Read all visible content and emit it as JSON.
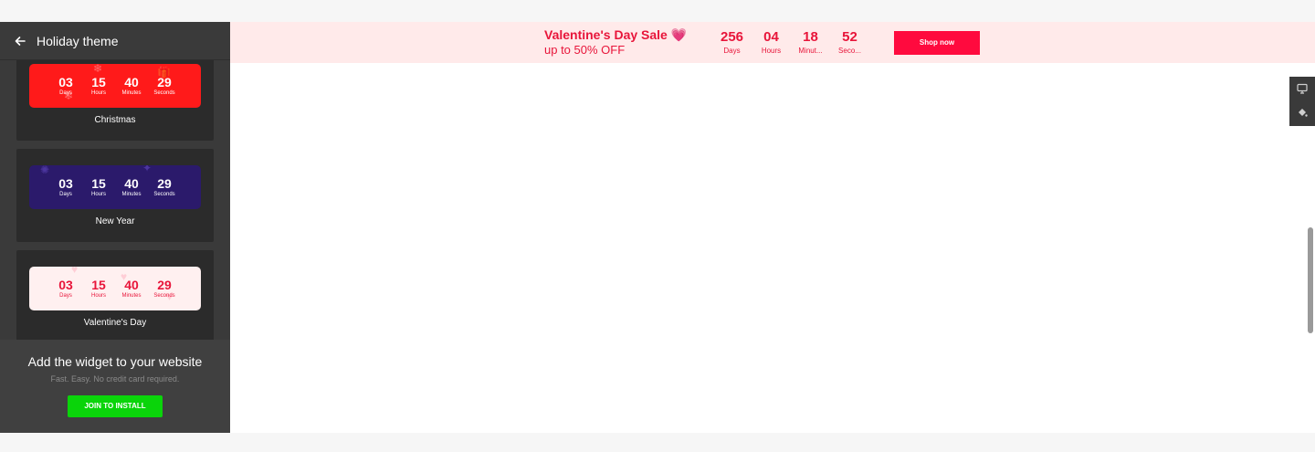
{
  "sidebar": {
    "title": "Holiday theme",
    "themes": [
      {
        "name": "Christmas",
        "timer": [
          {
            "value": "03",
            "label": "Days"
          },
          {
            "value": "15",
            "label": "Hours"
          },
          {
            "value": "40",
            "label": "Minutes"
          },
          {
            "value": "29",
            "label": "Seconds"
          }
        ]
      },
      {
        "name": "New Year",
        "timer": [
          {
            "value": "03",
            "label": "Days"
          },
          {
            "value": "15",
            "label": "Hours"
          },
          {
            "value": "40",
            "label": "Minutes"
          },
          {
            "value": "29",
            "label": "Seconds"
          }
        ]
      },
      {
        "name": "Valentine's Day",
        "timer": [
          {
            "value": "03",
            "label": "Days"
          },
          {
            "value": "15",
            "label": "Hours"
          },
          {
            "value": "40",
            "label": "Minutes"
          },
          {
            "value": "29",
            "label": "Seconds"
          }
        ]
      }
    ],
    "footer": {
      "title": "Add the widget to your website",
      "subtitle": "Fast. Easy. No credit card required.",
      "button": "JOIN TO INSTALL"
    }
  },
  "banner": {
    "title": "Valentine's Day Sale 💗",
    "subtitle": "up to 50% OFF",
    "timer": [
      {
        "value": "256",
        "label": "Days"
      },
      {
        "value": "04",
        "label": "Hours"
      },
      {
        "value": "18",
        "label": "Minut..."
      },
      {
        "value": "52",
        "label": "Seco..."
      }
    ],
    "button": "Shop now"
  },
  "colors": {
    "accent": "#e8153a",
    "join_button": "#0ad40a",
    "sidebar_bg": "#3a3a3a"
  },
  "icons": {
    "back": "back-arrow-icon",
    "desktop": "desktop-icon",
    "paint": "paint-bucket-icon"
  }
}
